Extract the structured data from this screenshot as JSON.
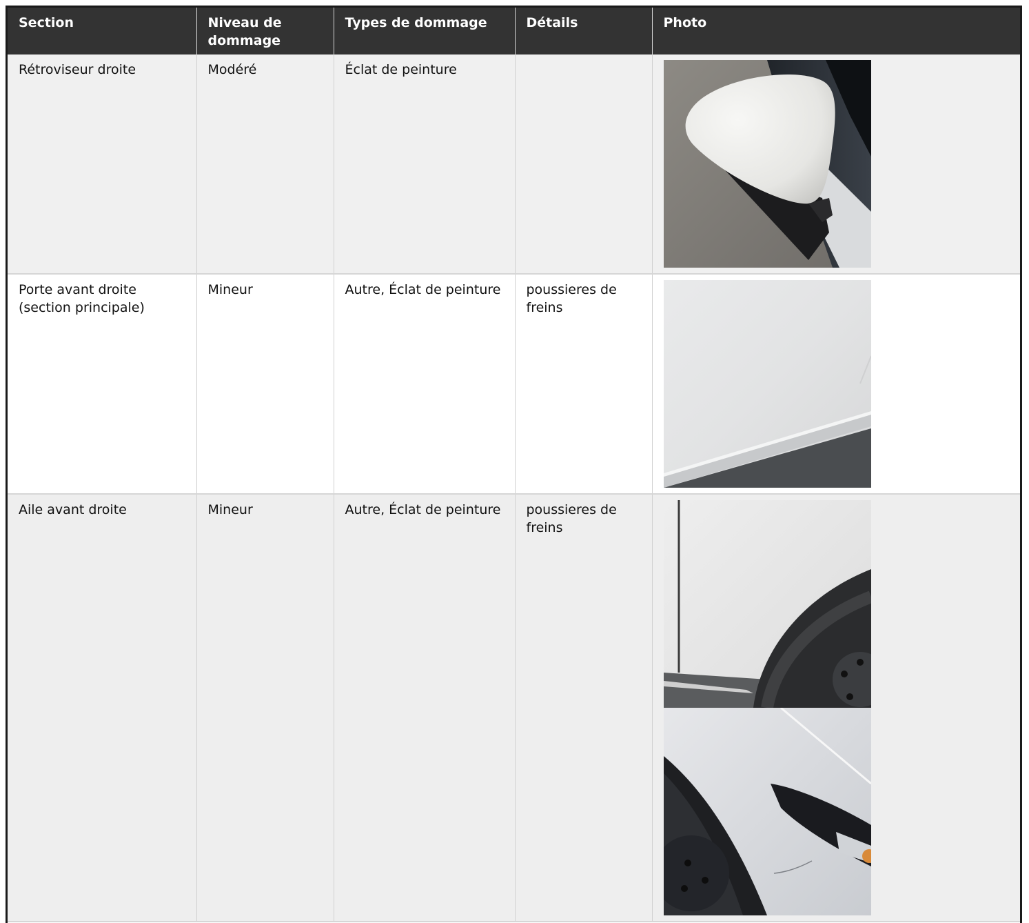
{
  "table": {
    "headers": [
      "Section",
      "Niveau de dommage",
      "Types de dommage",
      "Détails",
      "Photo"
    ],
    "rows": [
      {
        "section": "Rétroviseur droite",
        "niveau": "Modéré",
        "types": "Éclat de peinture",
        "details": "",
        "photos": [
          "mirror-photo"
        ]
      },
      {
        "section": "Porte avant droite (section principale)",
        "niveau": "Mineur",
        "types": "Autre, Éclat de peinture",
        "details": "poussieres de freins",
        "photos": [
          "door-photo"
        ]
      },
      {
        "section": "Aile avant droite",
        "niveau": "Mineur",
        "types": "Autre, Éclat de peinture",
        "details": "poussieres de freins",
        "photos": [
          "fender-photo-1",
          "fender-photo-2"
        ]
      }
    ]
  }
}
